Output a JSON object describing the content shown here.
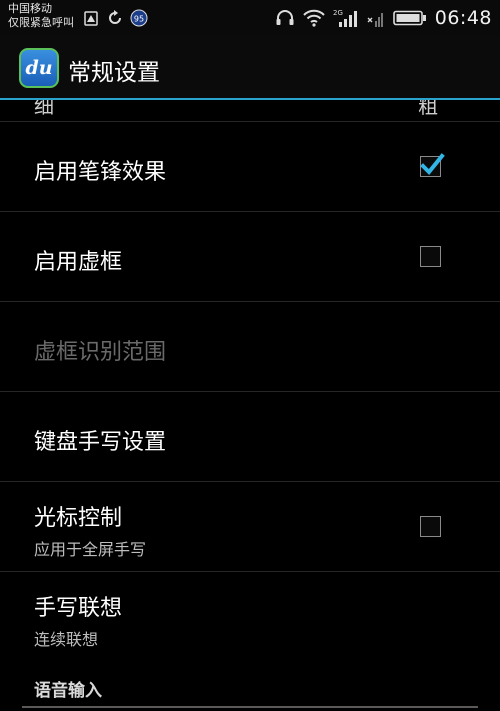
{
  "status_bar": {
    "carrier_line1": "中国移动",
    "carrier_line2": "仅限紧急呼叫",
    "badge_number": "95",
    "network_type": "2G",
    "time": "06:48"
  },
  "action_bar": {
    "app_icon_text": "du",
    "title": "常规设置"
  },
  "list": {
    "cut_row": {
      "left": "细",
      "right": "粗"
    },
    "items": [
      {
        "label": "启用笔锋效果",
        "checked": true
      },
      {
        "label": "启用虚框",
        "checked": false
      },
      {
        "label": "虚框识别范围",
        "disabled": true
      },
      {
        "label": "键盘手写设置"
      },
      {
        "label": "光标控制",
        "sub": "应用于全屏手写",
        "checked": false
      },
      {
        "label": "手写联想",
        "sub": "连续联想"
      }
    ],
    "section_header": "语音输入"
  },
  "colors": {
    "accent": "#2aa3cf",
    "check": "#33b5e5",
    "background": "#000000"
  }
}
